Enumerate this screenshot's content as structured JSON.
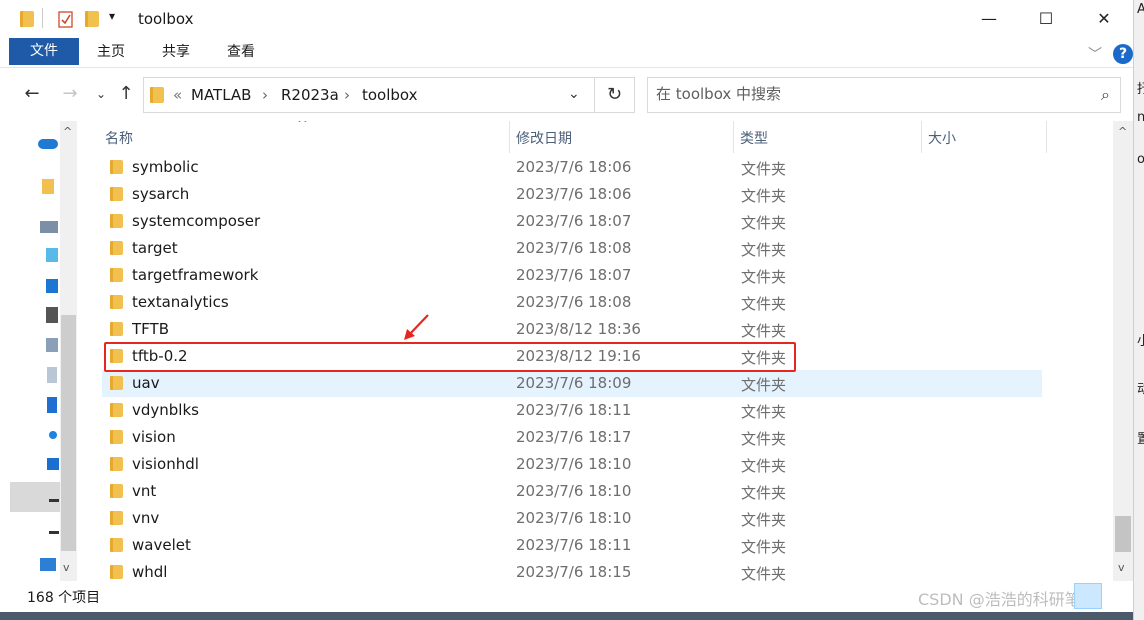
{
  "title_bar": {
    "title": "toolbox",
    "qat_dropdown": "▾",
    "minimize": "—",
    "maximize": "☐",
    "close": "✕"
  },
  "ribbon": {
    "tabs": [
      "文件",
      "主页",
      "共享",
      "查看"
    ],
    "help": "?"
  },
  "address": {
    "overflow": "«",
    "segments": [
      "MATLAB",
      "R2023a",
      "toolbox"
    ],
    "separator": "›"
  },
  "search": {
    "placeholder": "在 toolbox 中搜索"
  },
  "columns": {
    "name": "名称",
    "date": "修改日期",
    "type": "类型",
    "size": "大小"
  },
  "files": [
    {
      "name": "symbolic",
      "date": "2023/7/6 18:06",
      "type": "文件夹"
    },
    {
      "name": "sysarch",
      "date": "2023/7/6 18:06",
      "type": "文件夹"
    },
    {
      "name": "systemcomposer",
      "date": "2023/7/6 18:07",
      "type": "文件夹"
    },
    {
      "name": "target",
      "date": "2023/7/6 18:08",
      "type": "文件夹"
    },
    {
      "name": "targetframework",
      "date": "2023/7/6 18:07",
      "type": "文件夹"
    },
    {
      "name": "textanalytics",
      "date": "2023/7/6 18:08",
      "type": "文件夹"
    },
    {
      "name": "TFTB",
      "date": "2023/8/12 18:36",
      "type": "文件夹"
    },
    {
      "name": "tftb-0.2",
      "date": "2023/8/12 19:16",
      "type": "文件夹"
    },
    {
      "name": "uav",
      "date": "2023/7/6 18:09",
      "type": "文件夹"
    },
    {
      "name": "vdynblks",
      "date": "2023/7/6 18:11",
      "type": "文件夹"
    },
    {
      "name": "vision",
      "date": "2023/7/6 18:17",
      "type": "文件夹"
    },
    {
      "name": "visionhdl",
      "date": "2023/7/6 18:10",
      "type": "文件夹"
    },
    {
      "name": "vnt",
      "date": "2023/7/6 18:10",
      "type": "文件夹"
    },
    {
      "name": "vnv",
      "date": "2023/7/6 18:10",
      "type": "文件夹"
    },
    {
      "name": "wavelet",
      "date": "2023/7/6 18:11",
      "type": "文件夹"
    },
    {
      "name": "whdl",
      "date": "2023/7/6 18:15",
      "type": "文件夹"
    }
  ],
  "status": {
    "item_count": "168 个项目"
  },
  "watermark": "CSDN @浩浩的科研笔记",
  "right_strip_chars": [
    "A",
    "抒",
    "n",
    "o",
    "小",
    "动",
    "置"
  ],
  "colors": {
    "file_tab": "#1e5aa8",
    "highlight": "#e5281f",
    "hover_row": "#e5f3ff",
    "folder": "#f2c04e"
  }
}
